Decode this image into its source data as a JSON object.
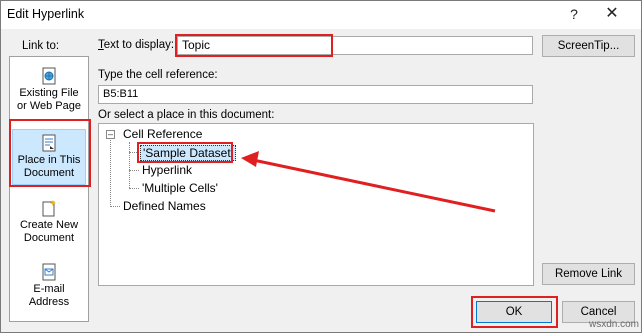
{
  "dialog": {
    "title": "Edit Hyperlink",
    "help_glyph": "?",
    "close_glyph": "✕"
  },
  "link_to": {
    "label": "Link to:",
    "items": [
      {
        "line1": "Existing File",
        "line2": "or Web Page",
        "icon": "web-page-icon"
      },
      {
        "line1": "Place in This",
        "line2": "Document",
        "icon": "document-place-icon"
      },
      {
        "line1": "Create New",
        "line2": "Document",
        "icon": "new-document-icon"
      },
      {
        "line1": "E-mail",
        "line2": "Address",
        "icon": "email-icon"
      }
    ]
  },
  "text_to_display": {
    "label": "Text to display:",
    "value": "Topic"
  },
  "screentip_label": "ScreenTip...",
  "cell_reference": {
    "label": "Type the cell reference:",
    "value": "B5:B11"
  },
  "place_select": {
    "label": "Or select a place in this document:",
    "tree": {
      "root": "Cell Reference",
      "children": [
        "'Sample Dataset'",
        "Hyperlink",
        "'Multiple Cells'"
      ],
      "second_root": "Defined Names"
    }
  },
  "buttons": {
    "remove_link": "Remove Link",
    "ok": "OK",
    "cancel": "Cancel"
  },
  "colors": {
    "annotation_red": "#e02020",
    "selection_blue": "#cce8ff"
  },
  "watermark": "wsxdn.com"
}
